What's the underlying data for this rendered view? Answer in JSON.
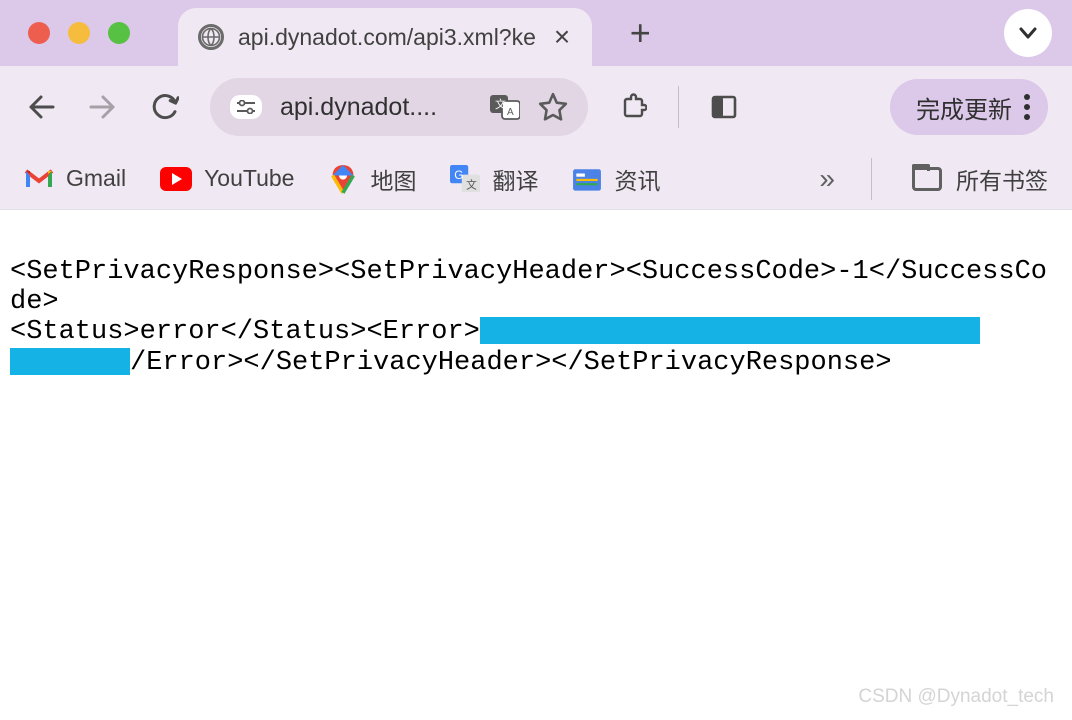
{
  "tab": {
    "title": "api.dynadot.com/api3.xml?ke",
    "close_label": "×"
  },
  "toolbar": {
    "url_display": "api.dynadot....",
    "update_label": "完成更新"
  },
  "bookmarks": {
    "items": [
      {
        "label": "Gmail"
      },
      {
        "label": "YouTube"
      },
      {
        "label": "地图"
      },
      {
        "label": "翻译"
      },
      {
        "label": "资讯"
      }
    ],
    "overflow": "»",
    "all_label": "所有书签"
  },
  "content": {
    "line1_a": "<SetPrivacyResponse><SetPrivacyHeader><SuccessCode>-1</SuccessCode>",
    "line1_b": "<Status>error</Status><Error>",
    "line2_b": "/Error></SetPrivacyHeader></SetPrivacyResponse>"
  },
  "watermark": "CSDN @Dynadot_tech"
}
